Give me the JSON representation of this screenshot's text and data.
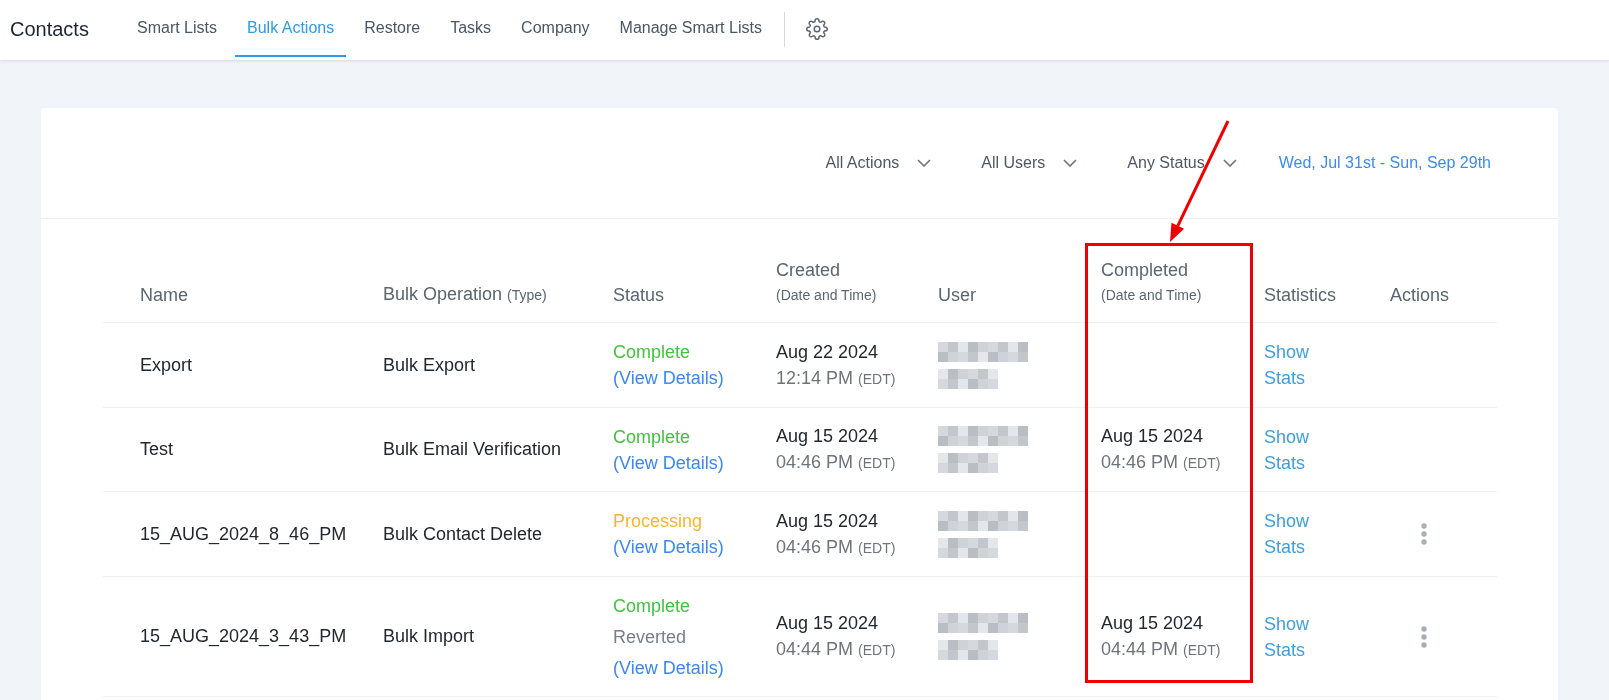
{
  "app": {
    "title": "Contacts"
  },
  "tabs": [
    {
      "label": "Smart Lists",
      "selected": false
    },
    {
      "label": "Bulk Actions",
      "selected": true
    },
    {
      "label": "Restore",
      "selected": false
    },
    {
      "label": "Tasks",
      "selected": false
    },
    {
      "label": "Company",
      "selected": false
    },
    {
      "label": "Manage Smart Lists",
      "selected": false
    }
  ],
  "filters": [
    {
      "label": "All Actions"
    },
    {
      "label": "All Users"
    },
    {
      "label": "Any Status"
    }
  ],
  "date_range": {
    "label": "Wed, Jul 31st - Sun, Sep 29th"
  },
  "table": {
    "columns": [
      {
        "label": "Name",
        "highlighted": false
      },
      {
        "label": "Bulk Operation",
        "note": "(Type)",
        "highlighted": false
      },
      {
        "label": "Status",
        "highlighted": false
      },
      {
        "label": "Created",
        "note": "(Date and Time)",
        "highlighted": false
      },
      {
        "label": "User",
        "highlighted": false
      },
      {
        "label": "Completed",
        "note": "(Date and Time)",
        "highlighted": true
      },
      {
        "label": "Statistics",
        "highlighted": false
      },
      {
        "label": "Actions",
        "highlighted": false
      }
    ],
    "rows": [
      {
        "name": "Export",
        "operation": "Bulk Export",
        "statuses": [
          {
            "label": "Complete",
            "kind": "complete"
          }
        ],
        "details_link": "(View Details)",
        "created": {
          "date": "Aug 22 2024",
          "time": "12:14 PM",
          "zone": "(EDT)"
        },
        "user": {
          "kind": "redacted"
        },
        "stats_link": "Show Stats",
        "has_menu": false
      },
      {
        "name": "Test",
        "operation": "Bulk Email Verification",
        "statuses": [
          {
            "label": "Complete",
            "kind": "complete"
          }
        ],
        "details_link": "(View Details)",
        "created": {
          "date": "Aug 15 2024",
          "time": "04:46 PM",
          "zone": "(EDT)"
        },
        "user": {
          "kind": "redacted"
        },
        "completed": {
          "date": "Aug 15 2024",
          "time": "04:46 PM",
          "zone": "(EDT)"
        },
        "stats_link": "Show Stats",
        "has_menu": false
      },
      {
        "name": "15_AUG_2024_8_46_PM",
        "operation": "Bulk Contact Delete",
        "statuses": [
          {
            "label": "Processing",
            "kind": "processing"
          }
        ],
        "details_link": "(View Details)",
        "created": {
          "date": "Aug 15 2024",
          "time": "04:46 PM",
          "zone": "(EDT)"
        },
        "user": {
          "kind": "redacted"
        },
        "stats_link": "Show Stats",
        "has_menu": true
      },
      {
        "name": "15_AUG_2024_3_43_PM",
        "operation": "Bulk Import",
        "statuses": [
          {
            "label": "Complete",
            "kind": "complete"
          },
          {
            "label": "Reverted",
            "kind": "reverted"
          }
        ],
        "details_link": "(View Details)",
        "created": {
          "date": "Aug 15 2024",
          "time": "04:44 PM",
          "zone": "(EDT)"
        },
        "user": {
          "kind": "redacted"
        },
        "completed": {
          "date": "Aug 15 2024",
          "time": "04:44 PM",
          "zone": "(EDT)"
        },
        "stats_link": "Show Stats",
        "has_menu": true
      }
    ]
  }
}
